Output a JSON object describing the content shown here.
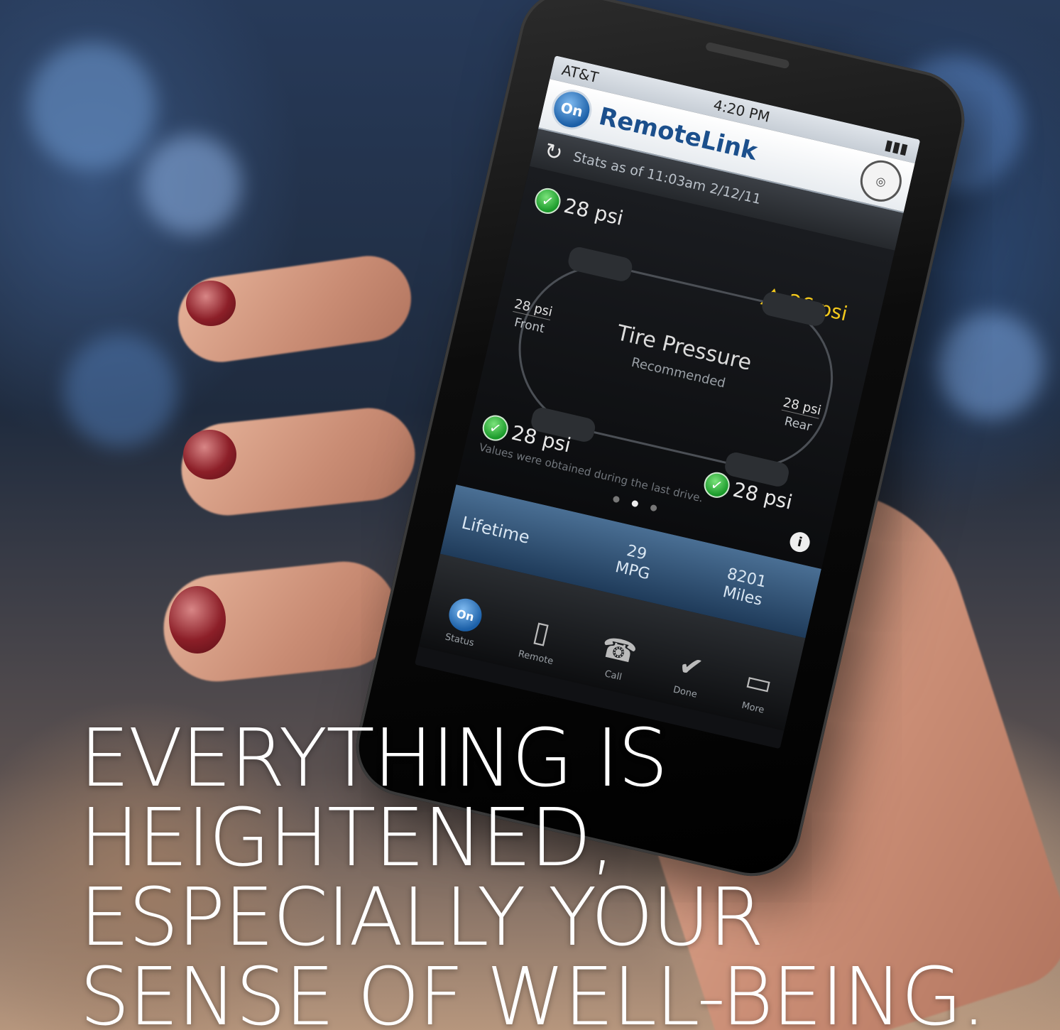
{
  "phone_screen": {
    "status_bar": {
      "carrier": "AT&T",
      "time": "4:20 PM"
    },
    "app_title": "RemoteLink",
    "logo_text": "On",
    "refresh_status": "Stats as of 11:03am 2/12/11",
    "tires": {
      "front_left": "28 psi",
      "front_right": "26 psi",
      "rear_left": "28 psi",
      "rear_right": "28 psi"
    },
    "center_title": "Tire Pressure",
    "center_subtitle": "Recommended",
    "front_label": {
      "value": "28 psi",
      "label": "Front"
    },
    "rear_label": {
      "value": "28 psi",
      "label": "Rear"
    },
    "note": "Values were obtained during the last drive.",
    "info_icon": "i",
    "lifetime": {
      "label": "Lifetime",
      "mpg_value": "29",
      "mpg_unit": "MPG",
      "miles_value": "8201",
      "miles_unit": "Miles"
    },
    "tabs": [
      {
        "label": "Status",
        "icon": "onstar-icon"
      },
      {
        "label": "Remote",
        "icon": "key-fob-icon"
      },
      {
        "label": "Call",
        "icon": "phone-icon"
      },
      {
        "label": "Done",
        "icon": "checkmark-icon"
      },
      {
        "label": "More",
        "icon": "car-icon"
      }
    ]
  },
  "headline": {
    "line1": "EVERYTHING IS",
    "line2": "HEIGHTENED,",
    "line3": "ESPECIALLY YOUR",
    "line4": "SENSE OF WELL-BEING."
  },
  "colors": {
    "warning": "#f2c81c",
    "ok": "#1a9a2a",
    "brand_blue": "#1b5fa7"
  }
}
